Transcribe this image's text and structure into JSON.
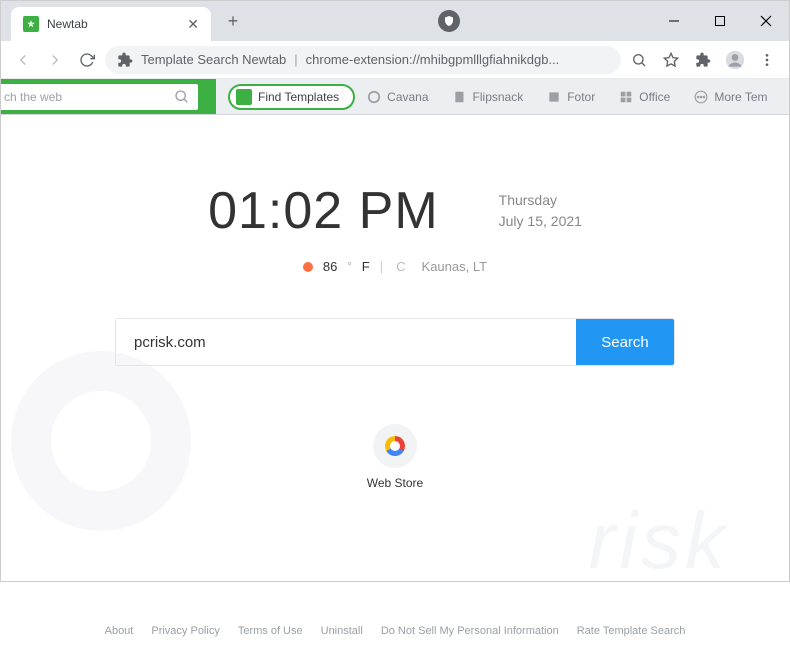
{
  "window": {
    "tab_title": "Newtab"
  },
  "omnibox": {
    "title": "Template Search Newtab",
    "url": "chrome-extension://mhibgpmlllgfiahnikdgb..."
  },
  "toolbar": {
    "search_placeholder": "ch the web",
    "find_templates": "Find Templates",
    "links": [
      {
        "label": "Cavana"
      },
      {
        "label": "Flipsnack"
      },
      {
        "label": "Fotor"
      },
      {
        "label": "Office"
      },
      {
        "label": "More Tem"
      }
    ]
  },
  "clock": {
    "time": "01:02 PM",
    "day": "Thursday",
    "date": "July 15, 2021"
  },
  "weather": {
    "temp": "86",
    "unit_f": "F",
    "unit_c": "C",
    "location": "Kaunas, LT"
  },
  "search": {
    "value": "pcrisk.com",
    "button": "Search"
  },
  "shortcuts": {
    "webstore": "Web Store"
  },
  "footer": {
    "about": "About",
    "privacy": "Privacy Policy",
    "terms": "Terms of Use",
    "uninstall": "Uninstall",
    "dns": "Do Not Sell My Personal Information",
    "rate": "Rate Template Search"
  }
}
